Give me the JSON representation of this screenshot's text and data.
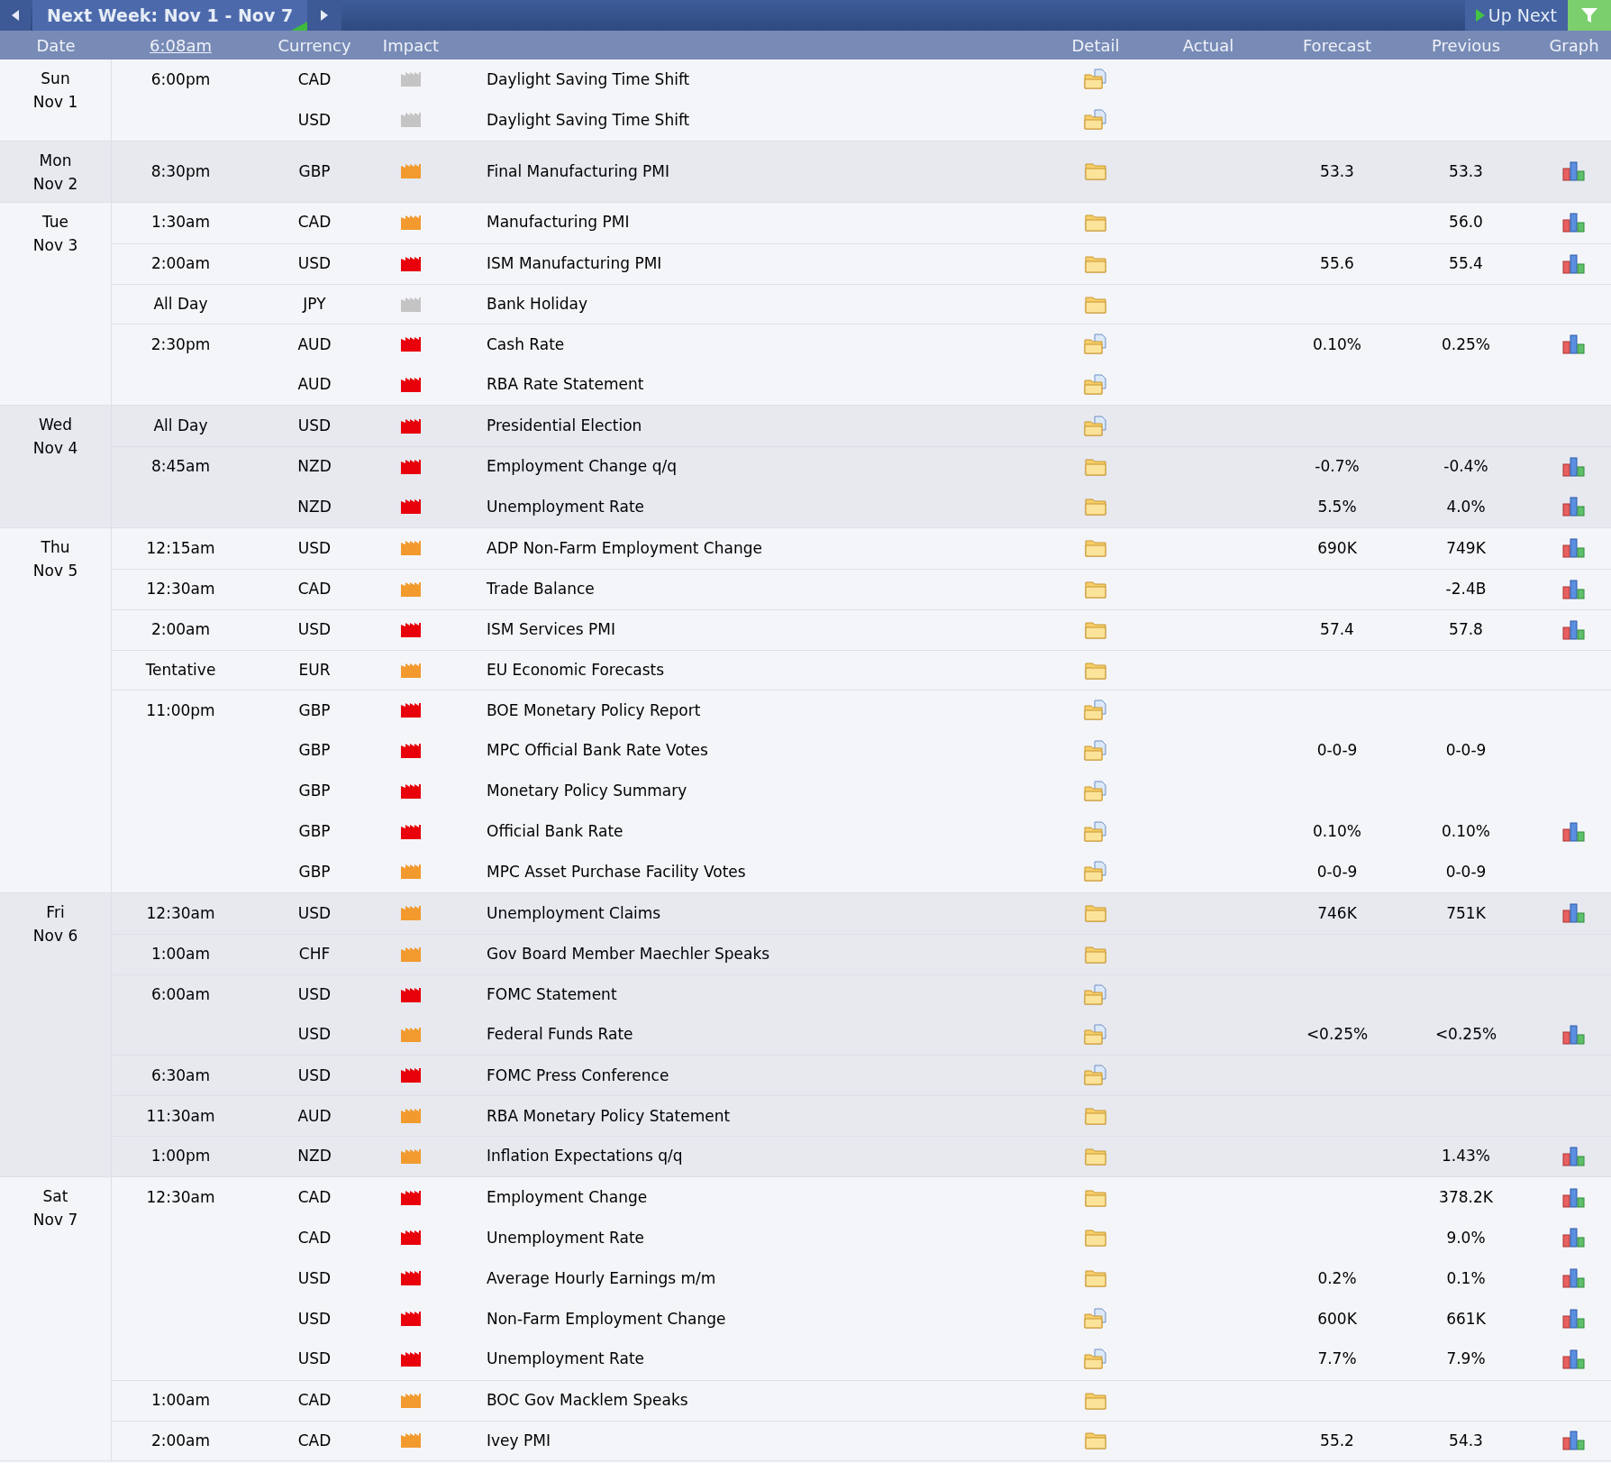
{
  "toolbar": {
    "title": "Next Week: Nov 1 - Nov 7",
    "up_next": "Up Next"
  },
  "columns": {
    "date": "Date",
    "time": "6:08am",
    "currency": "Currency",
    "impact": "Impact",
    "detail": "Detail",
    "actual": "Actual",
    "forecast": "Forecast",
    "previous": "Previous",
    "graph": "Graph"
  },
  "days": [
    {
      "day": "Sun",
      "date": "Nov 1",
      "events": [
        {
          "time": "6:00pm",
          "currency": "CAD",
          "color": "#c4c4c4",
          "title": "Daylight Saving Time Shift",
          "has_document": true,
          "graph": false
        },
        {
          "currency": "USD",
          "color": "#c4c4c4",
          "title": "Daylight Saving Time Shift",
          "has_document": true,
          "graph": false
        }
      ]
    },
    {
      "day": "Mon",
      "date": "Nov 2",
      "events": [
        {
          "time": "8:30pm",
          "currency": "GBP",
          "color": "#f29a2e",
          "title": "Final Manufacturing PMI",
          "has_document": false,
          "forecast": "53.3",
          "previous": "53.3",
          "graph": true
        }
      ]
    },
    {
      "day": "Tue",
      "date": "Nov 3",
      "events": [
        {
          "time": "1:30am",
          "currency": "CAD",
          "color": "#f29a2e",
          "title": "Manufacturing PMI",
          "has_document": false,
          "previous": "56.0",
          "graph": true
        },
        {
          "time": "2:00am",
          "currency": "USD",
          "color": "#e8000a",
          "title": "ISM Manufacturing PMI",
          "has_document": false,
          "forecast": "55.6",
          "previous": "55.4",
          "graph": true
        },
        {
          "time": "All Day",
          "currency": "JPY",
          "color": "#c4c4c4",
          "title": "Bank Holiday",
          "has_document": false,
          "graph": false
        },
        {
          "time": "2:30pm",
          "currency": "AUD",
          "color": "#e8000a",
          "title": "Cash Rate",
          "has_document": true,
          "forecast": "0.10%",
          "previous": "0.25%",
          "graph": true
        },
        {
          "currency": "AUD",
          "color": "#e8000a",
          "title": "RBA Rate Statement",
          "has_document": true,
          "graph": false
        }
      ]
    },
    {
      "day": "Wed",
      "date": "Nov 4",
      "events": [
        {
          "time": "All Day",
          "currency": "USD",
          "color": "#e8000a",
          "title": "Presidential Election",
          "has_document": true,
          "graph": false
        },
        {
          "time": "8:45am",
          "currency": "NZD",
          "color": "#e8000a",
          "title": "Employment Change q/q",
          "has_document": false,
          "forecast": "-0.7%",
          "previous": "-0.4%",
          "graph": true
        },
        {
          "currency": "NZD",
          "color": "#e8000a",
          "title": "Unemployment Rate",
          "has_document": false,
          "forecast": "5.5%",
          "previous": "4.0%",
          "graph": true
        }
      ]
    },
    {
      "day": "Thu",
      "date": "Nov 5",
      "events": [
        {
          "time": "12:15am",
          "currency": "USD",
          "color": "#f29a2e",
          "title": "ADP Non-Farm Employment Change",
          "has_document": false,
          "forecast": "690K",
          "previous": "749K",
          "graph": true
        },
        {
          "time": "12:30am",
          "currency": "CAD",
          "color": "#f29a2e",
          "title": "Trade Balance",
          "has_document": false,
          "previous": "-2.4B",
          "graph": true
        },
        {
          "time": "2:00am",
          "currency": "USD",
          "color": "#e8000a",
          "title": "ISM Services PMI",
          "has_document": false,
          "forecast": "57.4",
          "previous": "57.8",
          "graph": true
        },
        {
          "time": "Tentative",
          "currency": "EUR",
          "color": "#f29a2e",
          "title": "EU Economic Forecasts",
          "has_document": false,
          "graph": false
        },
        {
          "time": "11:00pm",
          "currency": "GBP",
          "color": "#e8000a",
          "title": "BOE Monetary Policy Report",
          "has_document": true,
          "graph": false
        },
        {
          "currency": "GBP",
          "color": "#e8000a",
          "title": "MPC Official Bank Rate Votes",
          "has_document": true,
          "forecast": "0-0-9",
          "previous": "0-0-9",
          "graph": false
        },
        {
          "currency": "GBP",
          "color": "#e8000a",
          "title": "Monetary Policy Summary",
          "has_document": true,
          "graph": false
        },
        {
          "currency": "GBP",
          "color": "#e8000a",
          "title": "Official Bank Rate",
          "has_document": true,
          "forecast": "0.10%",
          "previous": "0.10%",
          "graph": true
        },
        {
          "currency": "GBP",
          "color": "#f29a2e",
          "title": "MPC Asset Purchase Facility Votes",
          "has_document": true,
          "forecast": "0-0-9",
          "previous": "0-0-9",
          "graph": false
        }
      ]
    },
    {
      "day": "Fri",
      "date": "Nov 6",
      "events": [
        {
          "time": "12:30am",
          "currency": "USD",
          "color": "#f29a2e",
          "title": "Unemployment Claims",
          "has_document": false,
          "forecast": "746K",
          "previous": "751K",
          "graph": true
        },
        {
          "time": "1:00am",
          "currency": "CHF",
          "color": "#f29a2e",
          "title": "Gov Board Member Maechler Speaks",
          "has_document": false,
          "graph": false
        },
        {
          "time": "6:00am",
          "currency": "USD",
          "color": "#e8000a",
          "title": "FOMC Statement",
          "has_document": true,
          "graph": false
        },
        {
          "currency": "USD",
          "color": "#f29a2e",
          "title": "Federal Funds Rate",
          "has_document": true,
          "forecast": "<0.25%",
          "previous": "<0.25%",
          "graph": true
        },
        {
          "time": "6:30am",
          "currency": "USD",
          "color": "#e8000a",
          "title": "FOMC Press Conference",
          "has_document": true,
          "graph": false
        },
        {
          "time": "11:30am",
          "currency": "AUD",
          "color": "#f29a2e",
          "title": "RBA Monetary Policy Statement",
          "has_document": false,
          "graph": false
        },
        {
          "time": "1:00pm",
          "currency": "NZD",
          "color": "#f29a2e",
          "title": "Inflation Expectations q/q",
          "has_document": false,
          "previous": "1.43%",
          "graph": true
        }
      ]
    },
    {
      "day": "Sat",
      "date": "Nov 7",
      "events": [
        {
          "time": "12:30am",
          "currency": "CAD",
          "color": "#e8000a",
          "title": "Employment Change",
          "has_document": false,
          "previous": "378.2K",
          "graph": true
        },
        {
          "currency": "CAD",
          "color": "#e8000a",
          "title": "Unemployment Rate",
          "has_document": false,
          "previous": "9.0%",
          "graph": true
        },
        {
          "currency": "USD",
          "color": "#e8000a",
          "title": "Average Hourly Earnings m/m",
          "has_document": false,
          "forecast": "0.2%",
          "previous": "0.1%",
          "graph": true
        },
        {
          "currency": "USD",
          "color": "#e8000a",
          "title": "Non-Farm Employment Change",
          "has_document": true,
          "forecast": "600K",
          "previous": "661K",
          "graph": true
        },
        {
          "currency": "USD",
          "color": "#e8000a",
          "title": "Unemployment Rate",
          "has_document": true,
          "forecast": "7.7%",
          "previous": "7.9%",
          "graph": true
        },
        {
          "time": "1:00am",
          "currency": "CAD",
          "color": "#f29a2e",
          "title": "BOC Gov Macklem Speaks",
          "has_document": false,
          "graph": false
        },
        {
          "time": "2:00am",
          "currency": "CAD",
          "color": "#f29a2e",
          "title": "Ivey PMI",
          "has_document": false,
          "forecast": "55.2",
          "previous": "54.3",
          "graph": true
        }
      ]
    }
  ]
}
